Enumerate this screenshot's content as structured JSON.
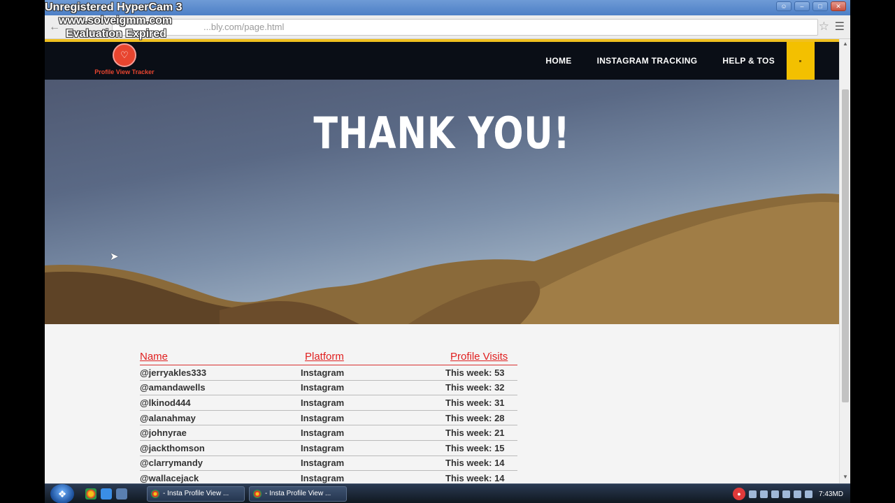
{
  "overlay": {
    "line1": "Unregistered HyperCam 3",
    "line2": "www.solveigmm.com",
    "line3": "Evaluation Expired"
  },
  "browser": {
    "url": "...bly.com/page.html",
    "back_icon": "back-arrow-icon",
    "star_icon": "star-icon",
    "menu_icon": "hamburger-menu-icon"
  },
  "site": {
    "logo_text": "Profile View Tracker",
    "nav": [
      {
        "label": "HOME"
      },
      {
        "label": "INSTAGRAM TRACKING"
      },
      {
        "label": "HELP & TOS"
      }
    ],
    "accent_color": "#f3c000",
    "hero_title": "THANK YOU!"
  },
  "table": {
    "headers": [
      "Name",
      "Platform",
      "Profile Visits"
    ],
    "rows": [
      {
        "name": "@jerryakles333",
        "platform": "Instagram",
        "visits": "This week:  53"
      },
      {
        "name": "@amandawells",
        "platform": "Instagram",
        "visits": "This week:  32"
      },
      {
        "name": "@lkinod444",
        "platform": "Instagram",
        "visits": "This week: 31"
      },
      {
        "name": "@alanahmay",
        "platform": "Instagram",
        "visits": "This week: 28"
      },
      {
        "name": "@johnyrae",
        "platform": "Instagram",
        "visits": "This week: 21"
      },
      {
        "name": "@jackthomson",
        "platform": "Instagram",
        "visits": "This week: 15"
      },
      {
        "name": "@clarrymandy",
        "platform": "Instagram",
        "visits": "This week: 14"
      },
      {
        "name": "@wallacejack",
        "platform": "Instagram",
        "visits": "This week: 14"
      }
    ]
  },
  "taskbar": {
    "tasks": [
      {
        "label": "- Insta Profile View ..."
      },
      {
        "label": "- Insta Profile View ..."
      }
    ],
    "clock": "7:43MD"
  }
}
